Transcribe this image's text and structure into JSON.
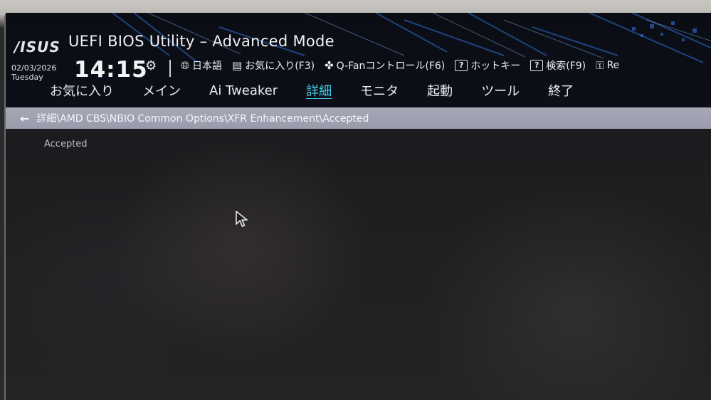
{
  "header": {
    "logo": "/ISUS",
    "title": "UEFI BIOS Utility – Advanced Mode",
    "date": "02/03/2026",
    "day": "Tuesday",
    "time": "14:15"
  },
  "toolbar": {
    "language": "日本語",
    "favorites": "お気に入り(F3)",
    "qfan": "Q-Fanコントロール(F6)",
    "hotkeys": "ホットキー",
    "search": "検索(F9)",
    "rog": "Re"
  },
  "tabs": [
    {
      "label": "お気に入り"
    },
    {
      "label": "メイン"
    },
    {
      "label": "Ai Tweaker"
    },
    {
      "label": "詳細"
    },
    {
      "label": "モニタ"
    },
    {
      "label": "起動"
    },
    {
      "label": "ツール"
    },
    {
      "label": "終了"
    }
  ],
  "breadcrumb": {
    "path": "詳細\\AMD CBS\\NBIO Common Options\\XFR Enhancement\\Accepted"
  },
  "content": {
    "item_label": "Accepted"
  },
  "colors": {
    "active_tab": "#3fd6f0",
    "breadcrumb_bar": "#a7a8b6"
  }
}
